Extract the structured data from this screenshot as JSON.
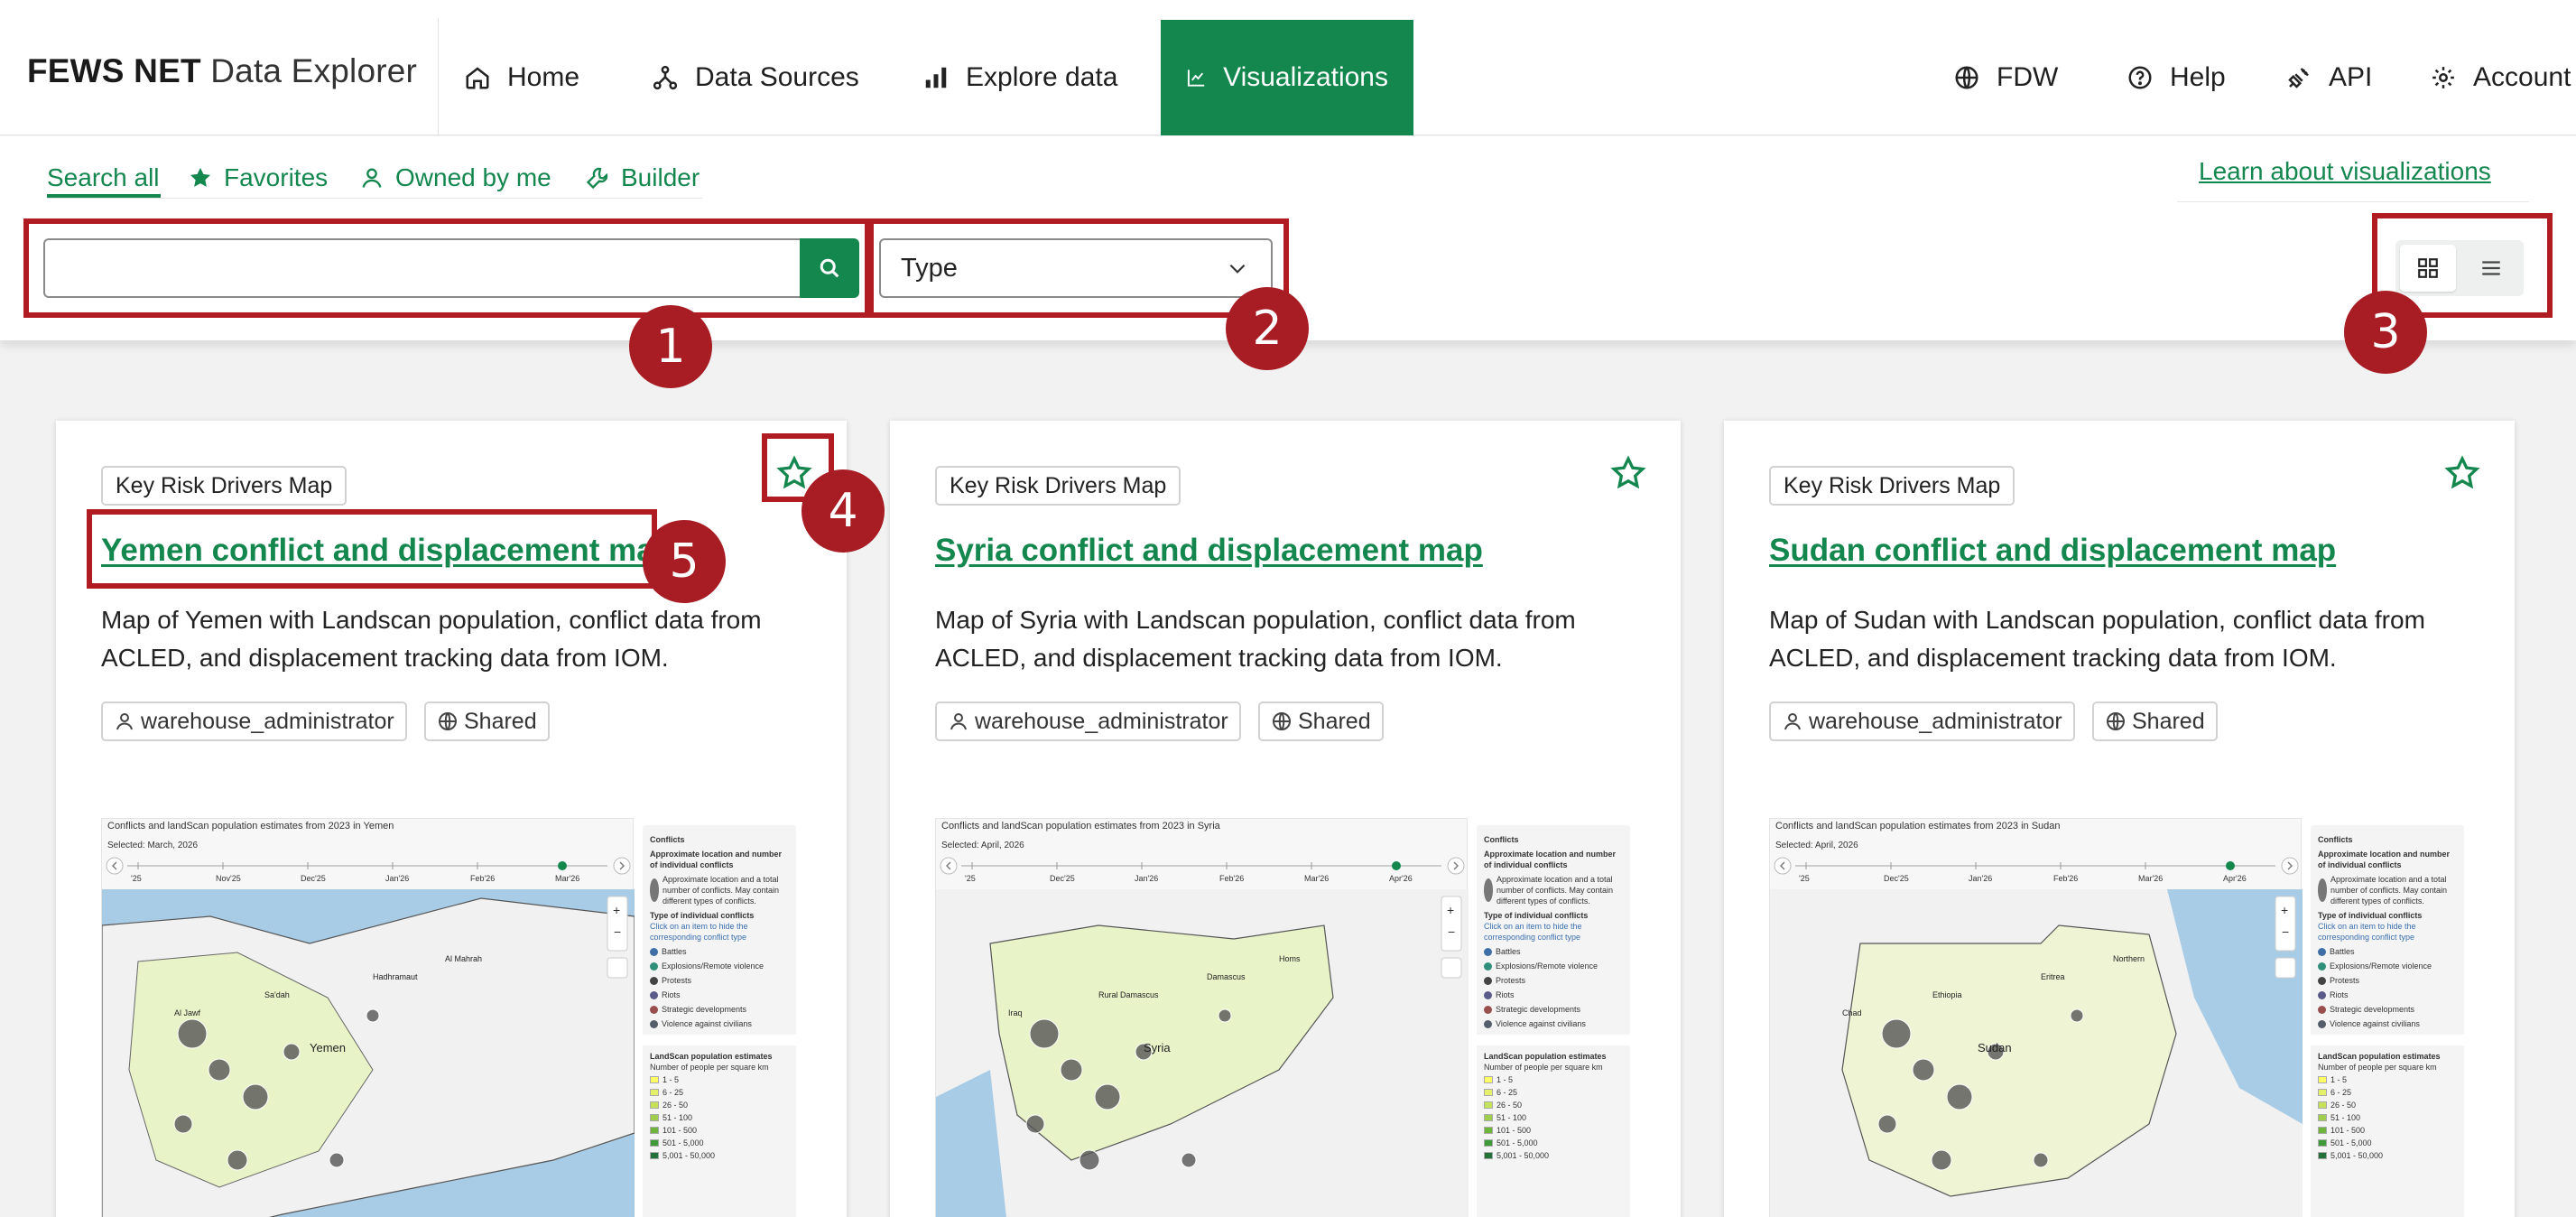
{
  "brand": {
    "bold": "FEWS NET",
    "light": "Data Explorer"
  },
  "nav": {
    "home": "Home",
    "data_sources": "Data Sources",
    "explore": "Explore data",
    "visualizations": "Visualizations",
    "fdw": "FDW",
    "help": "Help",
    "api": "API",
    "account": "Account"
  },
  "subnav": {
    "search_all": "Search all",
    "favorites": "Favorites",
    "owned": "Owned by me",
    "builder": "Builder",
    "learn": "Learn about visualizations"
  },
  "filters": {
    "search_value": "",
    "type_label": "Type"
  },
  "annotations": [
    "1",
    "2",
    "3",
    "4",
    "5"
  ],
  "colors": {
    "brand_green": "#14874f",
    "annotation_red": "#b01c22"
  },
  "cards": [
    {
      "type": "Key Risk Drivers Map",
      "title": "Yemen conflict and displacement map",
      "description": "Map of Yemen with Landscan population, conflict data from ACLED, and displacement tracking data from IOM.",
      "owner": "warehouse_administrator",
      "sharing": "Shared",
      "thumb_title": "Conflicts and landScan population estimates from 2023 in Yemen",
      "thumb_selected": "Selected: March, 2026",
      "thumb_months": [
        "'25",
        "Nov'25",
        "Dec'25",
        "Jan'26",
        "Feb'26",
        "Mar'26"
      ],
      "thumb_places": [
        "Yemen",
        "Al Jawf",
        "Hadhramaut",
        "Sa'dah",
        "Al Mahrah"
      ]
    },
    {
      "type": "Key Risk Drivers Map",
      "title": "Syria conflict and displacement map",
      "description": "Map of Syria with Landscan population, conflict data from ACLED, and displacement tracking data from IOM.",
      "owner": "warehouse_administrator",
      "sharing": "Shared",
      "thumb_title": "Conflicts and landScan population estimates from 2023 in Syria",
      "thumb_selected": "Selected: April, 2026",
      "thumb_months": [
        "'25",
        "Dec'25",
        "Jan'26",
        "Feb'26",
        "Mar'26",
        "Apr'26"
      ],
      "thumb_places": [
        "Syria",
        "Iraq",
        "Damascus",
        "Rural Damascus",
        "Homs"
      ]
    },
    {
      "type": "Key Risk Drivers Map",
      "title": "Sudan conflict and displacement map",
      "description": "Map of Sudan with Landscan population, conflict data from ACLED, and displacement tracking data from IOM.",
      "owner": "warehouse_administrator",
      "sharing": "Shared",
      "thumb_title": "Conflicts and landScan population estimates from 2023 in Sudan",
      "thumb_selected": "Selected: April, 2026",
      "thumb_months": [
        "'25",
        "Dec'25",
        "Jan'26",
        "Feb'26",
        "Mar'26",
        "Apr'26"
      ],
      "thumb_places": [
        "Sudan",
        "Chad",
        "Eritrea",
        "Ethiopia",
        "Northern"
      ]
    }
  ],
  "legend": {
    "conflicts_heading": "Conflicts",
    "approx_heading": "Approximate location and number of individual conflicts",
    "approx_text": "Approximate location and a total number of conflicts. May contain different types of conflicts.",
    "type_heading": "Type of individual conflicts",
    "type_hint": "Click on an item to hide the corresponding conflict type",
    "types": [
      {
        "label": "Battles",
        "color": "#3f6fa6"
      },
      {
        "label": "Explosions/Remote violence",
        "color": "#2f8f7a"
      },
      {
        "label": "Protests",
        "color": "#444444"
      },
      {
        "label": "Riots",
        "color": "#5b5b8a"
      },
      {
        "label": "Strategic developments",
        "color": "#9a4f4f"
      },
      {
        "label": "Violence against civilians",
        "color": "#555f6b"
      }
    ],
    "pop_heading": "LandScan population estimates",
    "pop_sub": "Number of people per square km",
    "pop_bins": [
      {
        "label": "1 - 5",
        "color": "#ffff66"
      },
      {
        "label": "6 - 25",
        "color": "#e4f06a"
      },
      {
        "label": "26 - 50",
        "color": "#c6e15c"
      },
      {
        "label": "51 - 100",
        "color": "#9fcf4a"
      },
      {
        "label": "101 - 500",
        "color": "#6fb53b"
      },
      {
        "label": "501 - 5,000",
        "color": "#3f9a3a"
      },
      {
        "label": "5,001 - 50,000",
        "color": "#24723a"
      }
    ]
  }
}
